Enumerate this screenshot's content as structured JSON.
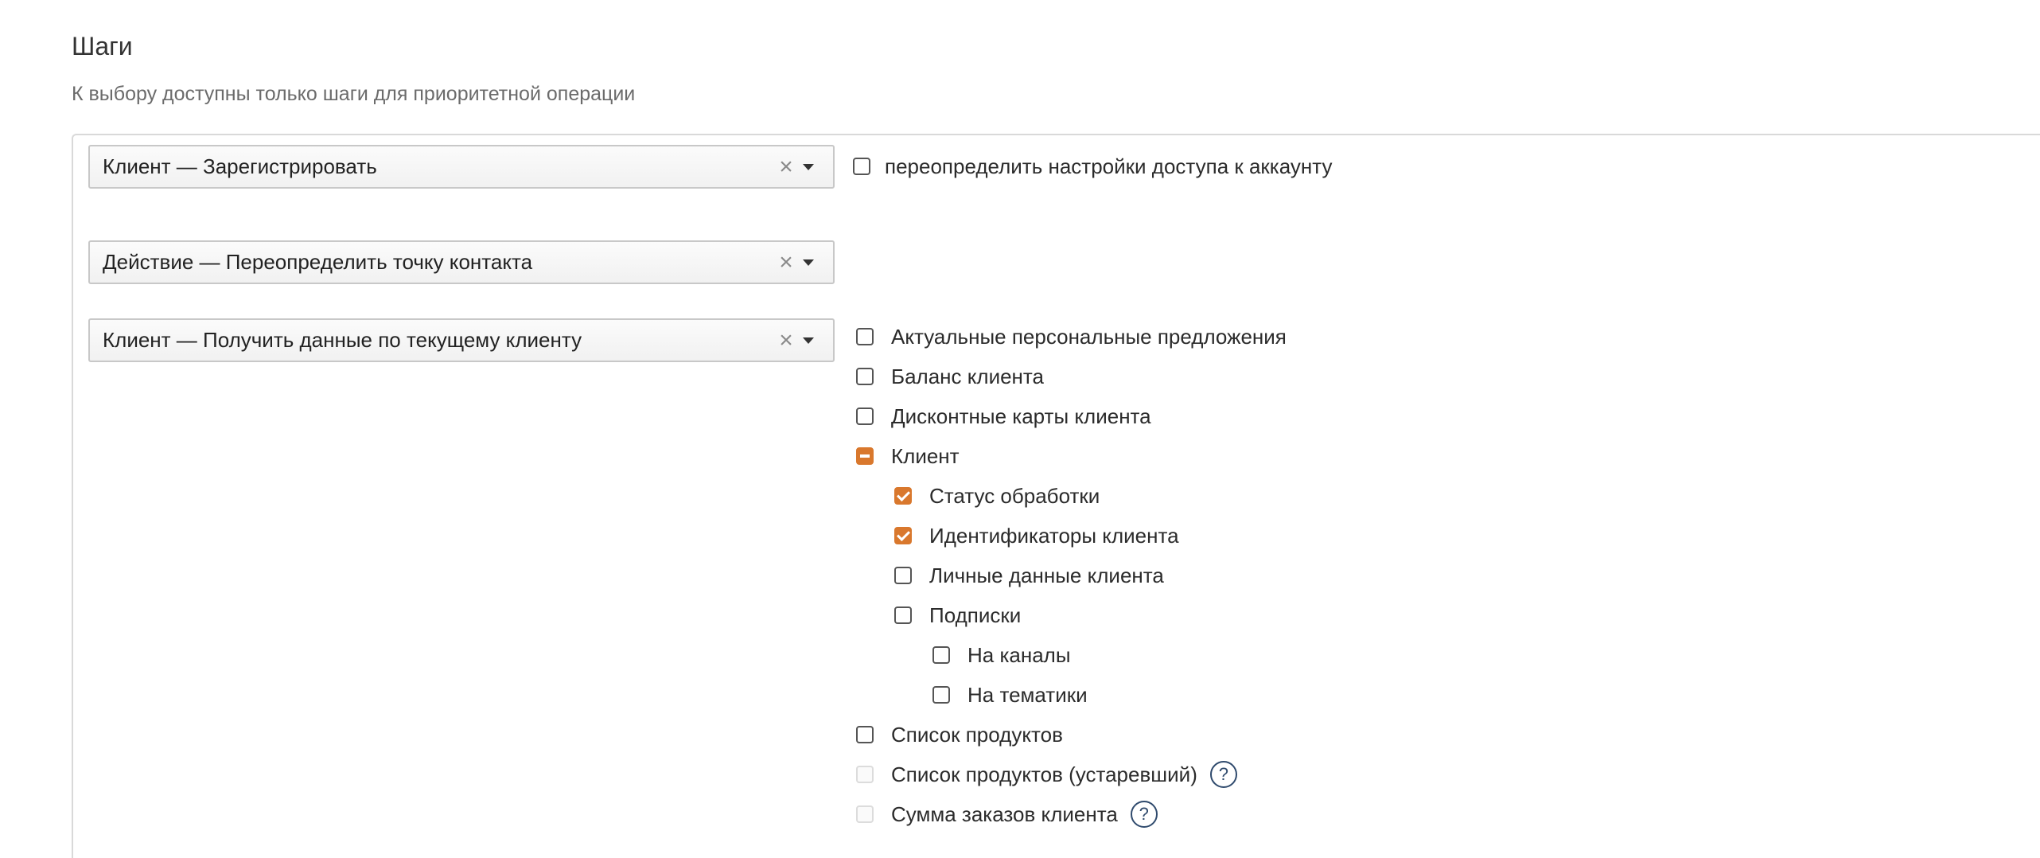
{
  "section": {
    "title": "Шаги",
    "subtitle": "К выбору доступны только шаги для приоритетной операции"
  },
  "steps": [
    {
      "value": "Клиент — Зарегистрировать",
      "clear_icon": "×"
    },
    {
      "value": "Действие — Переопределить точку контакта",
      "clear_icon": "×"
    },
    {
      "value": "Клиент — Получить данные по текущему клиенту",
      "clear_icon": "×"
    }
  ],
  "override_access": {
    "label": "переопределить настройки доступа к аккаунту",
    "checked": false
  },
  "data_options": [
    {
      "label": "Актуальные персональные предложения",
      "state": "unchecked"
    },
    {
      "label": "Баланс клиента",
      "state": "unchecked"
    },
    {
      "label": "Дисконтные карты клиента",
      "state": "unchecked"
    },
    {
      "label": "Клиент",
      "state": "partial"
    },
    {
      "label": "Статус обработки",
      "state": "checked"
    },
    {
      "label": "Идентификаторы клиента",
      "state": "checked"
    },
    {
      "label": "Личные данные клиента",
      "state": "unchecked"
    },
    {
      "label": "Подписки",
      "state": "unchecked"
    },
    {
      "label": "На каналы",
      "state": "unchecked"
    },
    {
      "label": "На тематики",
      "state": "unchecked"
    },
    {
      "label": "Список продуктов",
      "state": "unchecked"
    },
    {
      "label": "Список продуктов (устаревший)",
      "state": "disabled",
      "help": "?"
    },
    {
      "label": "Сумма заказов клиента",
      "state": "disabled",
      "help": "?"
    }
  ],
  "colors": {
    "accent": "#d9782d",
    "help_icon": "#2f4a6d"
  },
  "icons": {
    "clear": "close-icon",
    "caret": "chevron-down-icon",
    "help": "question-circle-icon"
  }
}
